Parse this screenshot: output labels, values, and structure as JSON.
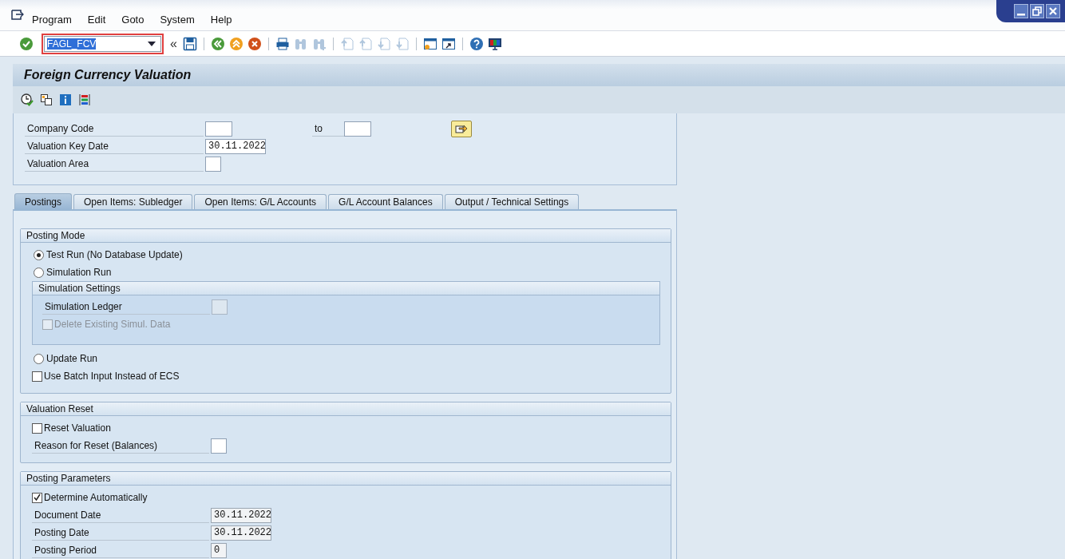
{
  "menu": [
    {
      "label": "Program"
    },
    {
      "label": "Edit"
    },
    {
      "label": "Goto"
    },
    {
      "label": "System"
    },
    {
      "label": "Help"
    }
  ],
  "command_field": {
    "value": "FAGL_FCV",
    "collapse": "«"
  },
  "toolbar": [
    {
      "kind": "save",
      "disabled": false
    },
    {
      "kind": "separator"
    },
    {
      "kind": "back",
      "disabled": false
    },
    {
      "kind": "exit",
      "disabled": false
    },
    {
      "kind": "cancel",
      "disabled": false
    },
    {
      "kind": "separator"
    },
    {
      "kind": "print",
      "disabled": false
    },
    {
      "kind": "find",
      "disabled": true
    },
    {
      "kind": "find-next",
      "disabled": true
    },
    {
      "kind": "separator"
    },
    {
      "kind": "first-page",
      "disabled": true
    },
    {
      "kind": "prev-page",
      "disabled": true
    },
    {
      "kind": "next-page",
      "disabled": true
    },
    {
      "kind": "last-page",
      "disabled": true
    },
    {
      "kind": "separator"
    },
    {
      "kind": "new-session",
      "disabled": false
    },
    {
      "kind": "shortcut",
      "disabled": false
    },
    {
      "kind": "separator"
    },
    {
      "kind": "help",
      "disabled": false
    },
    {
      "kind": "layout",
      "disabled": false
    }
  ],
  "title": "Foreign Currency Valuation",
  "app_toolbar": [
    {
      "kind": "execute"
    },
    {
      "kind": "variant"
    },
    {
      "kind": "info"
    },
    {
      "kind": "list"
    }
  ],
  "selection": [
    {
      "label": "Company Code",
      "kind": "code",
      "range_label": "to"
    },
    {
      "label": "Valuation Key Date",
      "kind": "date",
      "value": "30.11.2022"
    },
    {
      "label": "Valuation Area",
      "kind": "char"
    }
  ],
  "tabs": [
    {
      "label": "Postings",
      "selected": true
    },
    {
      "label": "Open Items: Subledger",
      "selected": false
    },
    {
      "label": "Open Items: G/L Accounts",
      "selected": false
    },
    {
      "label": "G/L Account Balances",
      "selected": false
    },
    {
      "label": "Output / Technical Settings",
      "selected": false
    }
  ],
  "sections": [
    {
      "title": "Posting Mode",
      "items": [
        {
          "kind": "radio",
          "label": "Test Run (No Database Update)",
          "selected": true
        },
        {
          "kind": "radio",
          "label": "Simulation Run",
          "selected": false
        },
        {
          "kind": "group",
          "title": "Simulation Settings",
          "items": [
            {
              "kind": "char-field",
              "label": "Simulation Ledger",
              "disabled": true
            },
            {
              "kind": "checkbox",
              "label": "Delete Existing Simul. Data",
              "checked": false,
              "disabled": true
            }
          ]
        },
        {
          "kind": "radio",
          "label": "Update Run",
          "selected": false
        },
        {
          "kind": "checkbox",
          "label": "Use Batch Input Instead of ECS",
          "checked": false,
          "disabled": false
        }
      ]
    },
    {
      "title": "Valuation Reset",
      "items": [
        {
          "kind": "checkbox",
          "label": "Reset Valuation",
          "checked": false,
          "disabled": false
        },
        {
          "kind": "char-field",
          "label": "Reason for Reset (Balances)",
          "disabled": false
        }
      ]
    },
    {
      "title": "Posting Parameters",
      "items": [
        {
          "kind": "checkbox",
          "label": "Determine Automatically",
          "checked": true,
          "disabled": false
        },
        {
          "kind": "date-field",
          "label": "Document Date",
          "value": "30.11.2022",
          "disabled": true
        },
        {
          "kind": "date-field",
          "label": "Posting Date",
          "value": "30.11.2022",
          "disabled": true
        },
        {
          "kind": "char-field",
          "label": "Posting Period",
          "value": "0",
          "disabled": true
        }
      ]
    }
  ]
}
